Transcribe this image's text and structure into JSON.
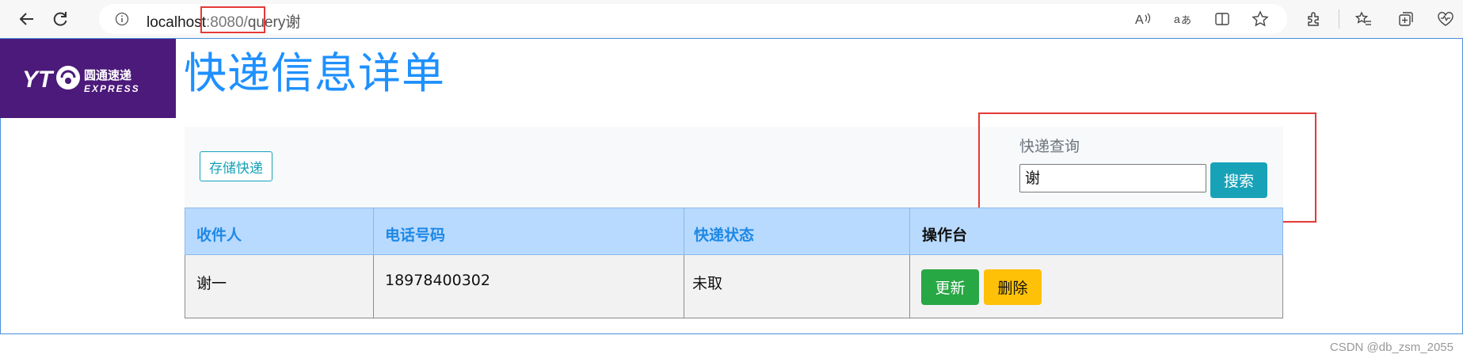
{
  "browser": {
    "url_host": "localhost",
    "url_port": ":8080",
    "url_slash": "/",
    "url_path": "query谢",
    "icons": [
      "back-icon",
      "refresh-icon",
      "info-icon",
      "read-aloud-icon",
      "translate-icon",
      "split-screen-icon",
      "favorite-star-icon",
      "extensions-icon",
      "favorites-icon",
      "collections-icon",
      "health-icon"
    ]
  },
  "header": {
    "logo_text": "YTO 圆通速递 EXPRESS",
    "title": "快递信息详单"
  },
  "toolbar": {
    "store_label": "存储快递",
    "search_label": "快递查询",
    "search_value": "谢",
    "search_button": "搜索"
  },
  "table": {
    "headers": [
      "收件人",
      "电话号码",
      "快递状态",
      "操作台"
    ],
    "rows": [
      {
        "name": "谢一",
        "phone": "18978400302",
        "status": "未取",
        "update_label": "更新",
        "delete_label": "删除"
      }
    ]
  },
  "colors": {
    "accent": "#1e90ff",
    "info": "#17a2b8",
    "success": "#28a745",
    "warning": "#ffc107",
    "table_header": "#b8daff",
    "logo_bg": "#4b1a7a",
    "highlight": "#e53935"
  },
  "watermark": "CSDN @db_zsm_2055"
}
